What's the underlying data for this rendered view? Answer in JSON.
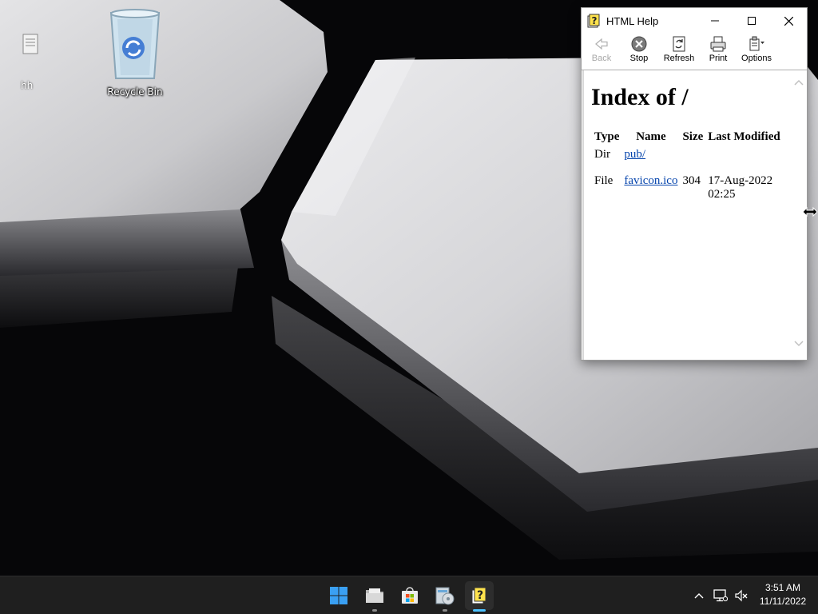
{
  "desktop": {
    "icons": [
      {
        "label": "Recycle Bin",
        "icon": "recycle-bin-icon"
      },
      {
        "label": "hh",
        "icon": "file-icon"
      }
    ]
  },
  "window": {
    "title": "HTML Help",
    "icon": "help-icon",
    "controls": {
      "minimize": "minimize-icon",
      "maximize": "maximize-icon",
      "close": "close-icon"
    },
    "toolbar": {
      "back": "Back",
      "stop": "Stop",
      "refresh": "Refresh",
      "print": "Print",
      "options": "Options"
    },
    "content": {
      "heading": "Index of /",
      "columns": [
        "Type",
        "Name",
        "Size",
        "Last Modified"
      ],
      "rows": [
        {
          "type": "Dir",
          "name": "pub/",
          "size": "",
          "modified": ""
        },
        {
          "type": "File",
          "name": "favicon.ico",
          "size": "304",
          "modified_date": "17-Aug-2022",
          "modified_time": "02:25"
        }
      ]
    }
  },
  "taskbar": {
    "apps": [
      "start-icon",
      "file-explorer-icon",
      "store-icon",
      "installer-icon",
      "html-help-icon"
    ],
    "active_app": "html-help-icon",
    "tray": [
      "chevron-up-icon",
      "network-icon",
      "volume-muted-icon"
    ],
    "clock": {
      "time": "3:51 AM",
      "date": "11/11/2022"
    }
  },
  "colors": {
    "taskbar": "#1f1f1f",
    "link": "#0645ad",
    "active_indicator": "#4cc2ff"
  }
}
